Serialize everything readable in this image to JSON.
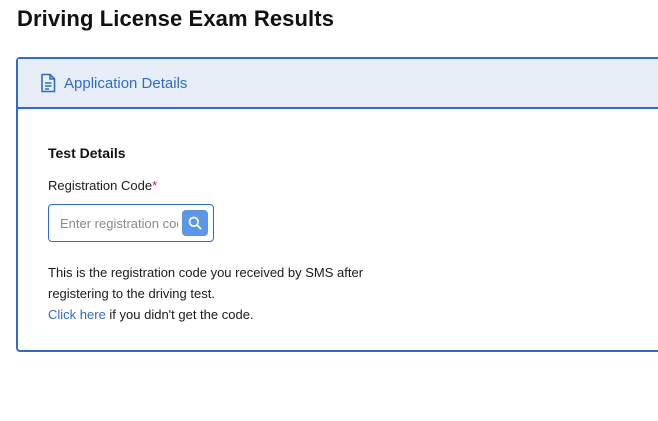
{
  "page": {
    "title": "Driving License Exam Results"
  },
  "card": {
    "header_label": "Application Details",
    "header_icon": "document-icon",
    "section_title": "Test Details",
    "field": {
      "label": "Registration Code",
      "required_marker": "*",
      "placeholder": "Enter registration code",
      "value": ""
    },
    "search_icon": "search-icon",
    "help": {
      "line1": "This is the registration code you received by SMS after registering to the driving test.",
      "link_text": "Click here",
      "link_suffix": " if you didn't get the code."
    }
  },
  "colors": {
    "accent": "#2f6cc6",
    "header_bg": "#e7eef8",
    "button_bg": "#5b97e6",
    "required": "#d11a2a"
  }
}
